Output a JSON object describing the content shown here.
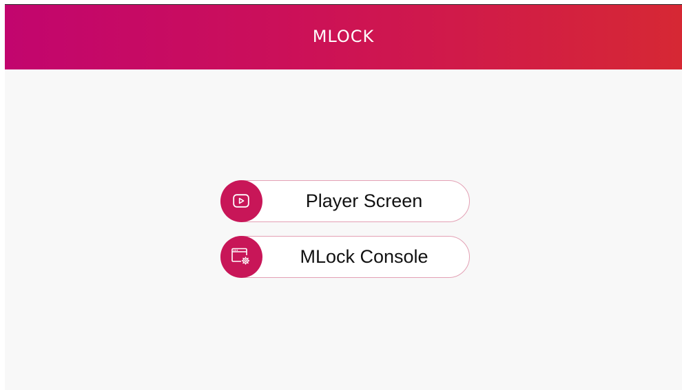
{
  "app": {
    "title": "MLOCK"
  },
  "menu": {
    "items": [
      {
        "label": "Player Screen",
        "icon": "play-video-icon"
      },
      {
        "label": "MLock Console",
        "icon": "console-settings-icon"
      }
    ]
  },
  "colors": {
    "header_gradient_start": "#c2056e",
    "header_gradient_end": "#d62834",
    "accent": "#c81658",
    "button_border": "#e3a0b4",
    "background": "#f8f8f8"
  }
}
